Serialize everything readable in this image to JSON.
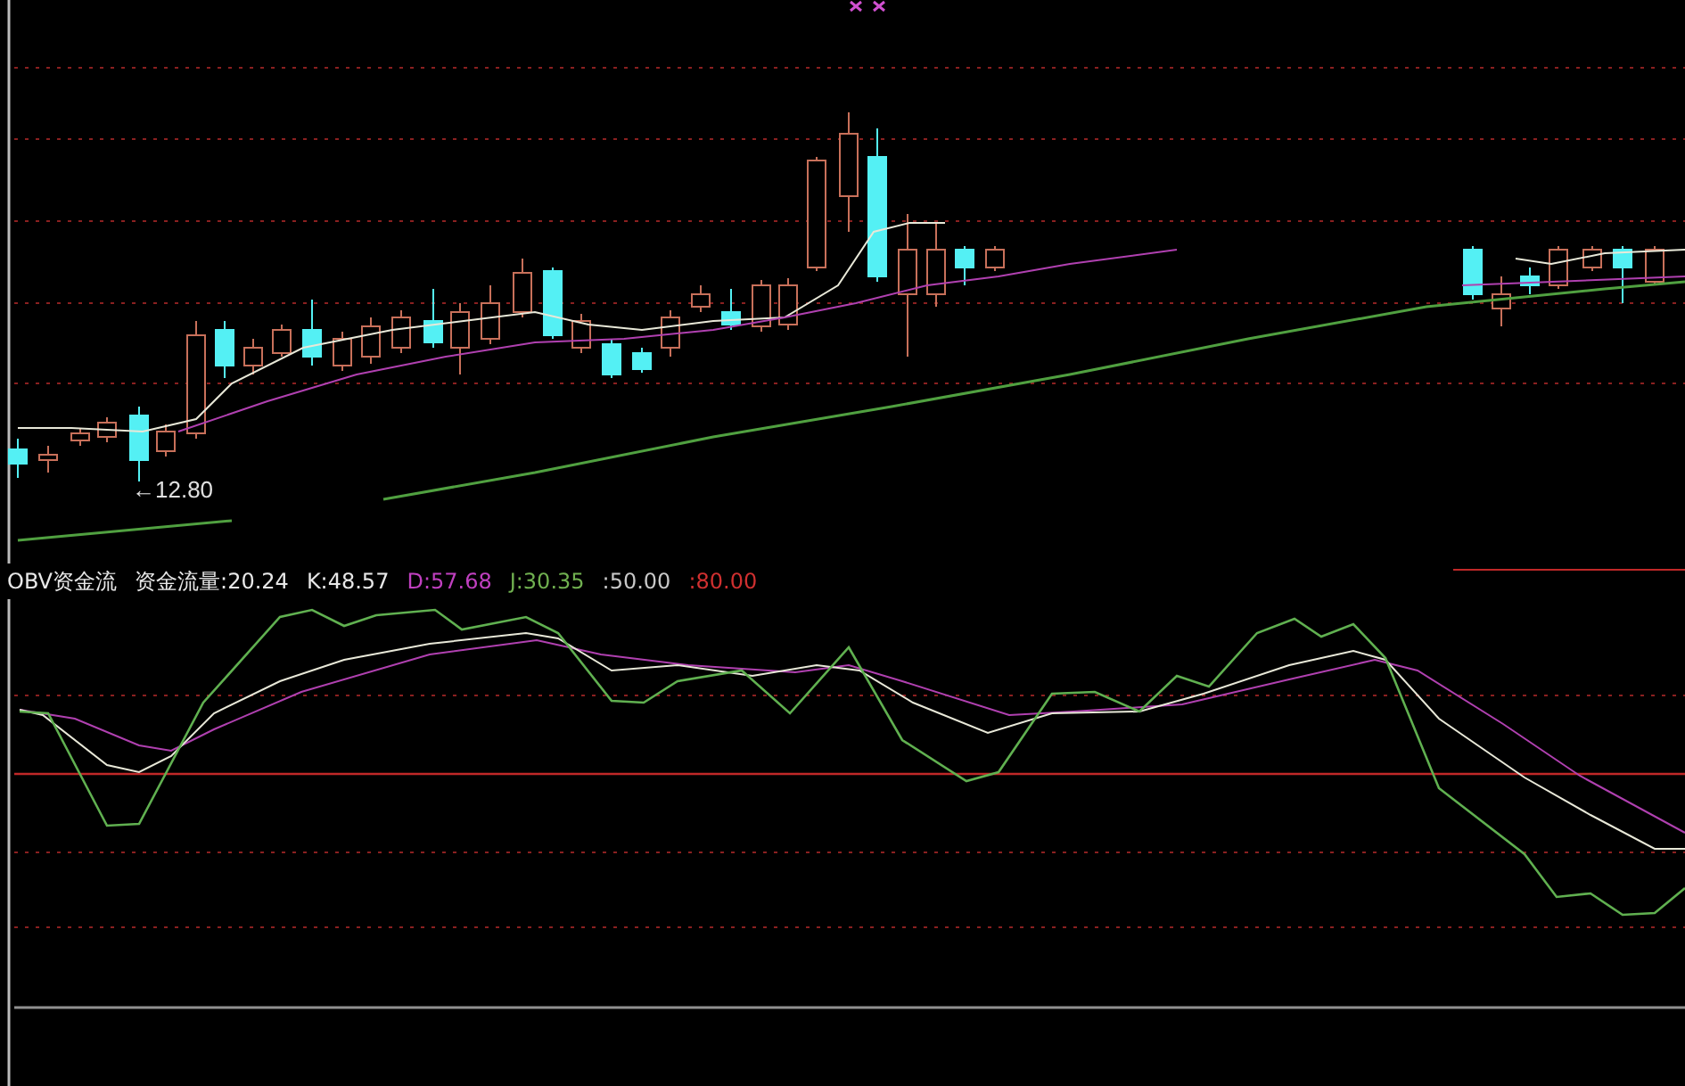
{
  "price_chart": {
    "price_label": "←12.80"
  },
  "indicator": {
    "legend": [
      {
        "text": "OBV资金流",
        "color": "#e8e8e8"
      },
      {
        "text": "资金流量:20.24",
        "color": "#e8e8e8"
      },
      {
        "text": "K:48.57",
        "color": "#e8e8e8"
      },
      {
        "text": "D:57.68",
        "color": "#c040c0"
      },
      {
        "text": "J:30.35",
        "color": "#70b050"
      },
      {
        "text": ":50.00",
        "color": "#c8c8c8"
      },
      {
        "text": ":80.00",
        "color": "#d03030"
      }
    ]
  }
}
